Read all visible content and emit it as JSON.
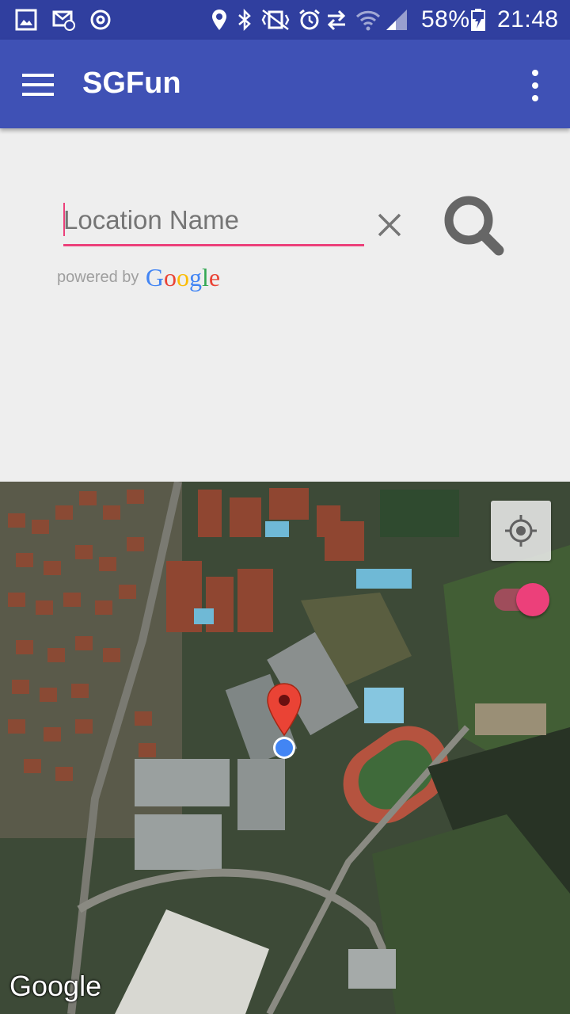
{
  "status_bar": {
    "battery": "58%",
    "time": "21:48",
    "icons": [
      "gallery-icon",
      "email-icon",
      "sync-icon",
      "location-icon",
      "bluetooth-icon",
      "vibrate-icon",
      "alarm-icon",
      "data-transfer-icon",
      "wifi-icon",
      "signal-icon",
      "battery-charging-icon"
    ]
  },
  "app_bar": {
    "title": "SGFun",
    "menu_icon": "hamburger-menu-icon",
    "overflow_icon": "more-vert-icon"
  },
  "search": {
    "placeholder": "Location Name",
    "value": "",
    "clear_icon": "close-icon",
    "search_icon": "search-icon",
    "powered_by": "powered by",
    "google_logo": "Google"
  },
  "map": {
    "watermark": "Google",
    "locate_icon": "my-location-icon",
    "toggle_on": true,
    "marker_icon": "map-pin-icon",
    "current_location_icon": "current-location-dot-icon"
  },
  "colors": {
    "primary": "#3f51b5",
    "primary_dark": "#303f9f",
    "accent": "#ec407a"
  }
}
